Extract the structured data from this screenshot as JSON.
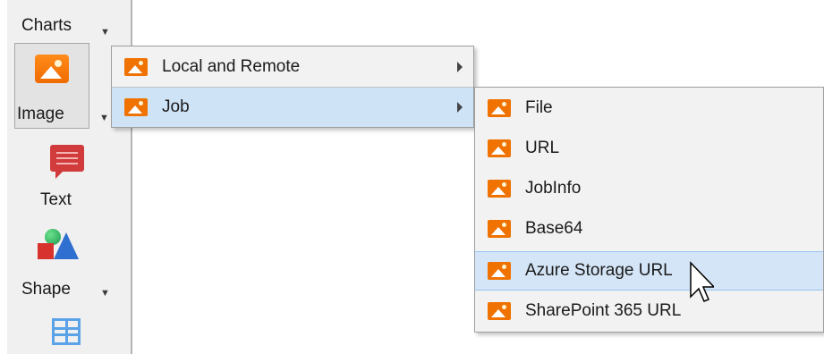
{
  "toolbar": {
    "charts_label": "Charts",
    "image_label": "Image",
    "text_label": "Text",
    "shape_label": "Shape"
  },
  "menu_level1": {
    "items": [
      {
        "label": "Local and Remote",
        "icon": "image-icon",
        "has_submenu": true,
        "highlighted": false
      },
      {
        "label": "Job",
        "icon": "image-icon",
        "has_submenu": true,
        "highlighted": true
      }
    ]
  },
  "menu_level2": {
    "items": [
      {
        "label": "File",
        "icon": "image-icon"
      },
      {
        "label": "URL",
        "icon": "image-icon"
      },
      {
        "label": "JobInfo",
        "icon": "image-icon"
      },
      {
        "label": "Base64",
        "icon": "image-icon"
      },
      {
        "label": "Azure Storage URL",
        "icon": "image-icon",
        "highlighted": true
      },
      {
        "label": "SharePoint 365 URL",
        "icon": "image-icon"
      }
    ]
  },
  "colors": {
    "highlight": "#cfe3f7",
    "menu_bg": "#f2f2f2",
    "image_icon": "#f07200"
  }
}
